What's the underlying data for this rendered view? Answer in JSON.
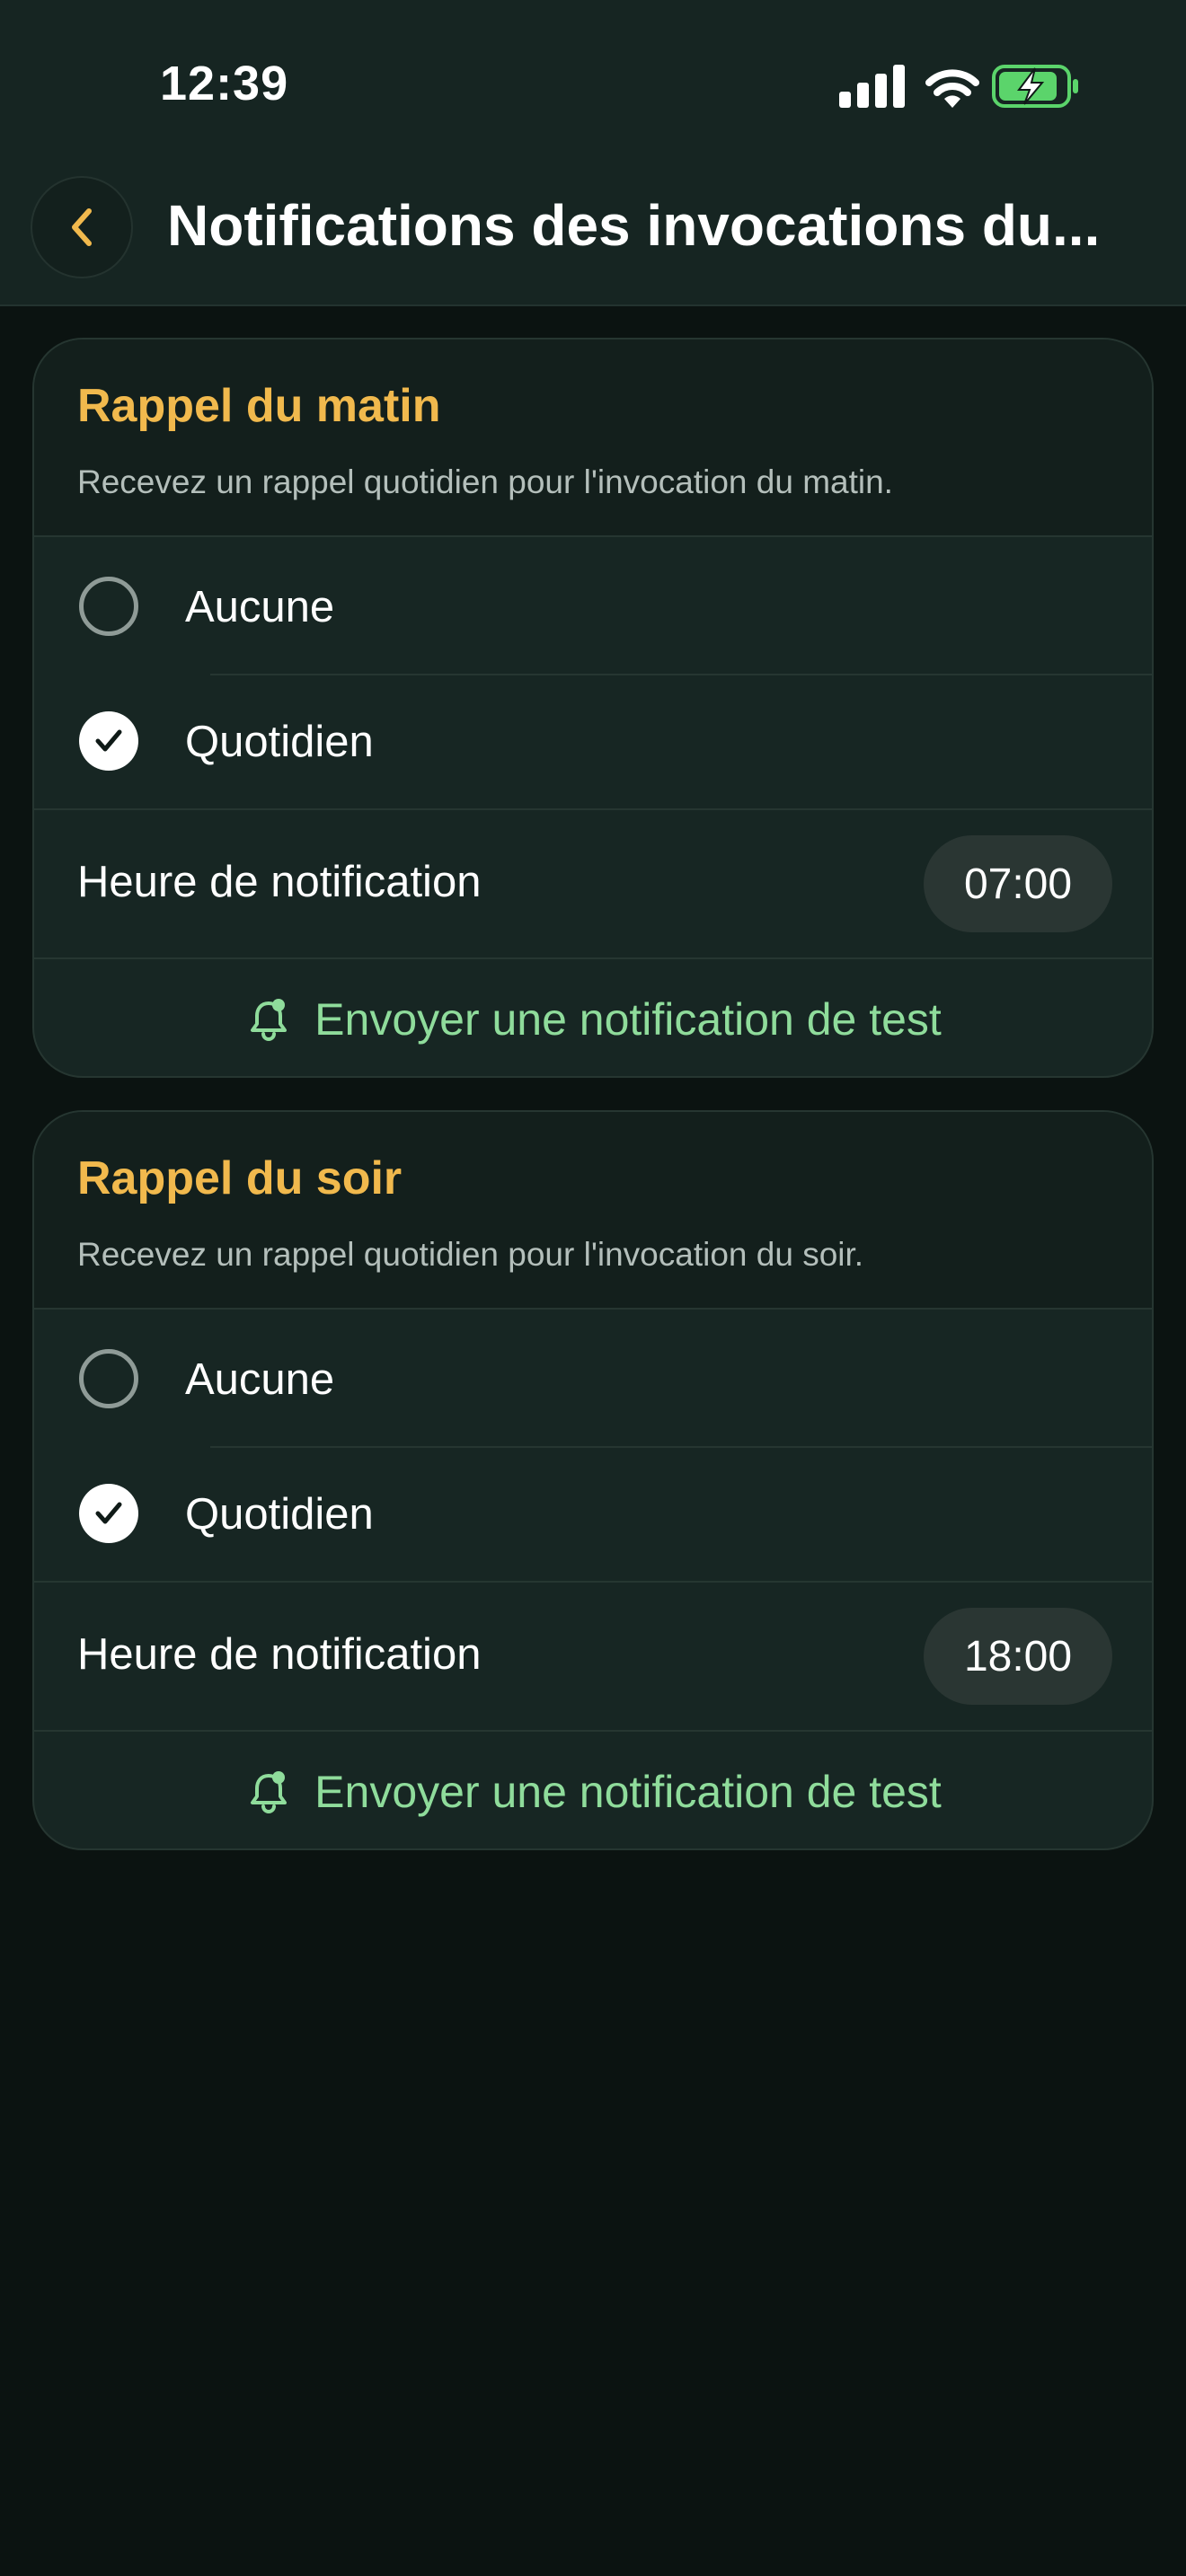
{
  "status_bar": {
    "time": "12:39",
    "icons": [
      "cellular-signal-icon",
      "wifi-icon",
      "battery-charging-icon"
    ]
  },
  "header": {
    "back_icon": "chevron-left-icon",
    "title": "Notifications des invocations du..."
  },
  "colors": {
    "accent_yellow": "#f1b94d",
    "accent_green": "#8fdc9b",
    "battery_green": "#5bd46b",
    "background": "#0b1311",
    "card": "#172623"
  },
  "cards": [
    {
      "title": "Rappel du matin",
      "description": "Recevez un rappel quotidien pour l'invocation du matin.",
      "options": [
        {
          "label": "Aucune",
          "selected": false
        },
        {
          "label": "Quotidien",
          "selected": true
        }
      ],
      "time_label": "Heure de notification",
      "time_value": "07:00",
      "test_label": "Envoyer une notification de test",
      "test_icon": "bell-icon"
    },
    {
      "title": "Rappel du soir",
      "description": "Recevez un rappel quotidien pour l'invocation du soir.",
      "options": [
        {
          "label": "Aucune",
          "selected": false
        },
        {
          "label": "Quotidien",
          "selected": true
        }
      ],
      "time_label": "Heure de notification",
      "time_value": "18:00",
      "test_label": "Envoyer une notification de test",
      "test_icon": "bell-icon"
    }
  ]
}
